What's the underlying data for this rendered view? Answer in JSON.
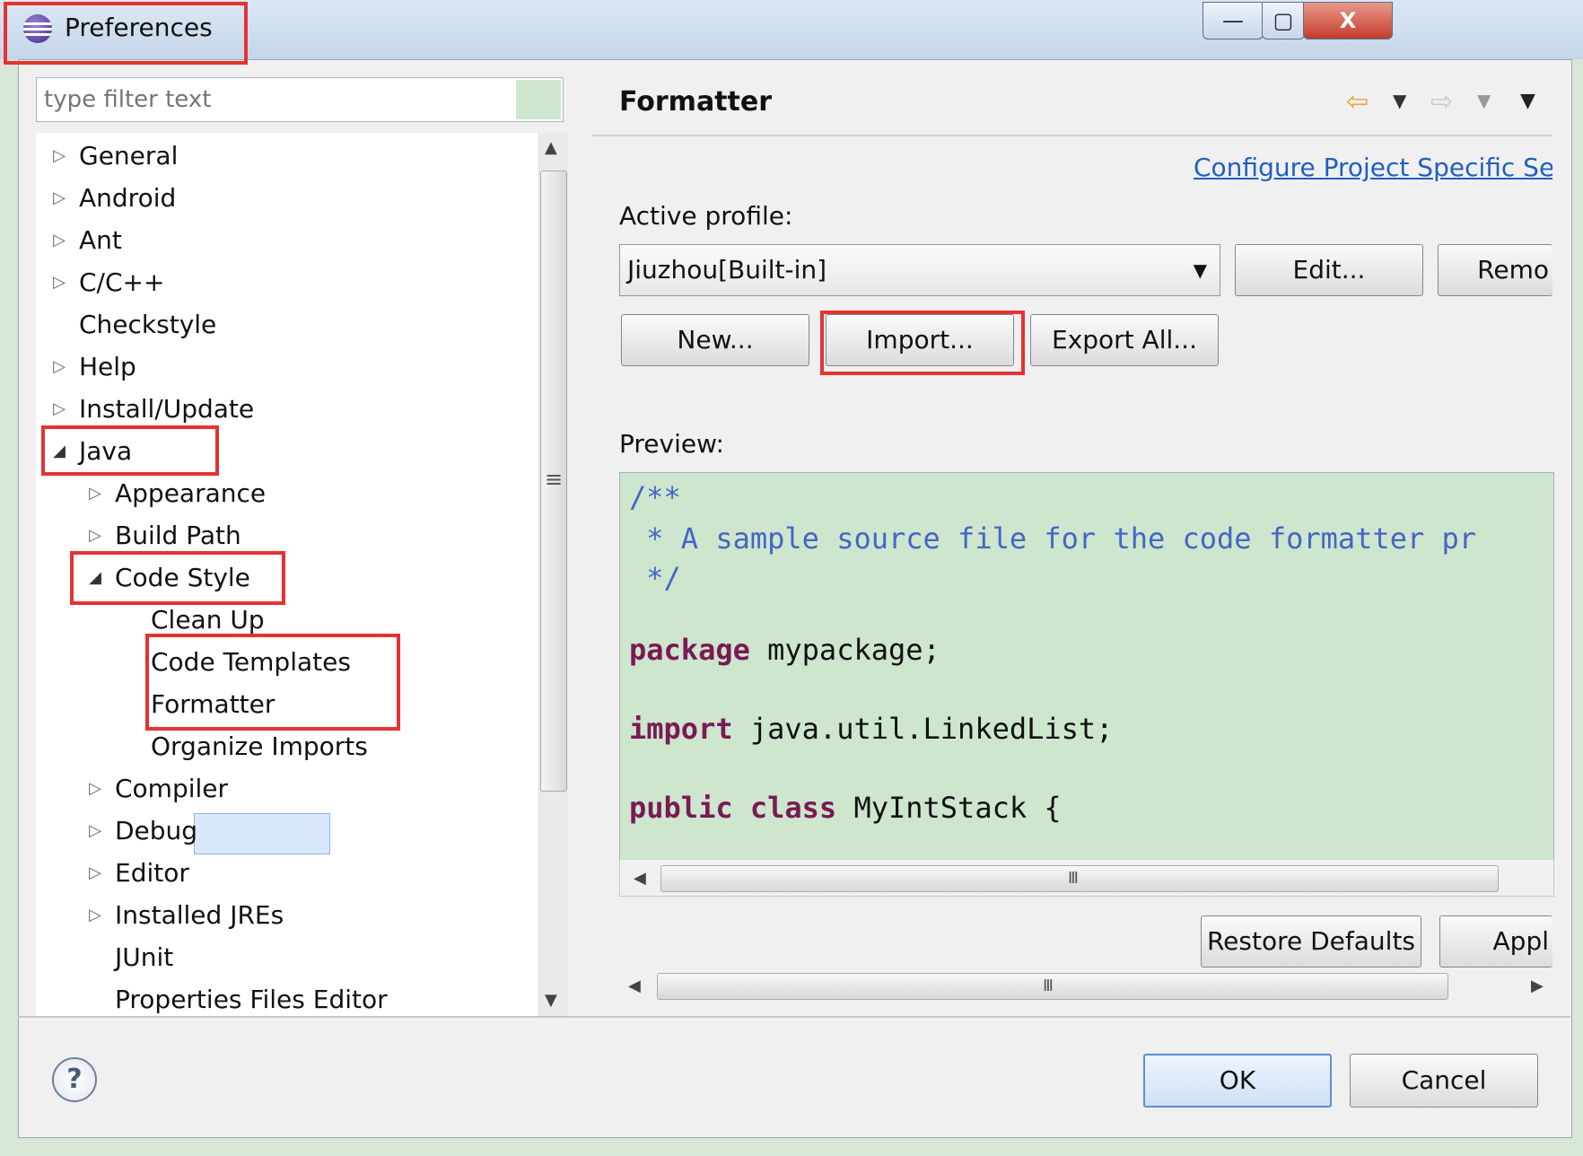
{
  "window": {
    "title": "Preferences",
    "controls": {
      "minimize": "—",
      "maximize": "▢",
      "close": "X"
    }
  },
  "filter": {
    "placeholder": "type filter text"
  },
  "tree": {
    "items": [
      {
        "label": "General",
        "expander": "▷"
      },
      {
        "label": "Android",
        "expander": "▷"
      },
      {
        "label": "Ant",
        "expander": "▷"
      },
      {
        "label": "C/C++",
        "expander": "▷"
      },
      {
        "label": "Checkstyle",
        "expander": ""
      },
      {
        "label": "Help",
        "expander": "▷"
      },
      {
        "label": "Install/Update",
        "expander": "▷"
      },
      {
        "label": "Java",
        "expander": "◢"
      },
      {
        "label": "Appearance",
        "expander": "▷"
      },
      {
        "label": "Build Path",
        "expander": "▷"
      },
      {
        "label": "Code Style",
        "expander": "◢"
      },
      {
        "label": "Clean Up",
        "expander": ""
      },
      {
        "label": "Code Templates",
        "expander": ""
      },
      {
        "label": "Formatter",
        "expander": ""
      },
      {
        "label": "Organize Imports",
        "expander": ""
      },
      {
        "label": "Compiler",
        "expander": "▷"
      },
      {
        "label": "Debug",
        "expander": "▷"
      },
      {
        "label": "Editor",
        "expander": "▷"
      },
      {
        "label": "Installed JREs",
        "expander": "▷"
      },
      {
        "label": "JUnit",
        "expander": ""
      },
      {
        "label": "Properties Files Editor",
        "expander": ""
      }
    ],
    "scroll_grip": "≡"
  },
  "page": {
    "title": "Formatter",
    "configure_link": "Configure Project Specific Set",
    "active_profile_label": "Active profile:",
    "active_profile_value": "Jiuzhou[Built-in]",
    "buttons": {
      "edit": "Edit...",
      "remove": "Remo",
      "new": "New...",
      "import": "Import...",
      "export_all": "Export All...",
      "restore_defaults": "Restore Defaults",
      "apply": "Appl"
    },
    "preview_label": "Preview:",
    "preview_code": {
      "line1": "/**",
      "line2": " * A sample source file for the code formatter pr",
      "line3": " */",
      "package_kw": "package",
      "package_rest": " mypackage;",
      "import_kw": "import",
      "import_rest": " java.util.LinkedList;",
      "public_kw": "public class",
      "class_rest": " MyIntStack {"
    },
    "scroll_grip": "III"
  },
  "footer": {
    "help": "?",
    "ok": "OK",
    "cancel": "Cancel"
  },
  "colors": {
    "highlight_red": "#e53232",
    "link_blue": "#1f5fc0",
    "comment_blue": "#4565c6",
    "keyword_purple": "#7a1a54",
    "preview_bg": "#cde6cd"
  }
}
